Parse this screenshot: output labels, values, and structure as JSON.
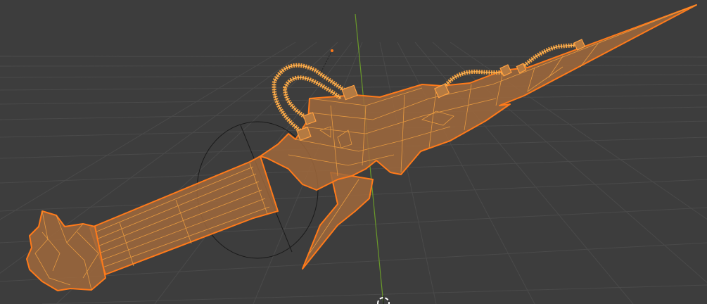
{
  "viewport": {
    "type": "3d-viewport",
    "object_state": "selected-wireframe-overlay",
    "selection_color": "#ff7a1a",
    "edge_color": "#f0a040",
    "background_color": "#3d3d3d",
    "grid_color": "#4a4a4a",
    "y_axis_color": "#6a9a2a"
  },
  "icons": {
    "empty_object": "empty-icon",
    "camera_circle": "rotation-circle-icon",
    "cursor_3d": "3d-cursor-icon"
  }
}
